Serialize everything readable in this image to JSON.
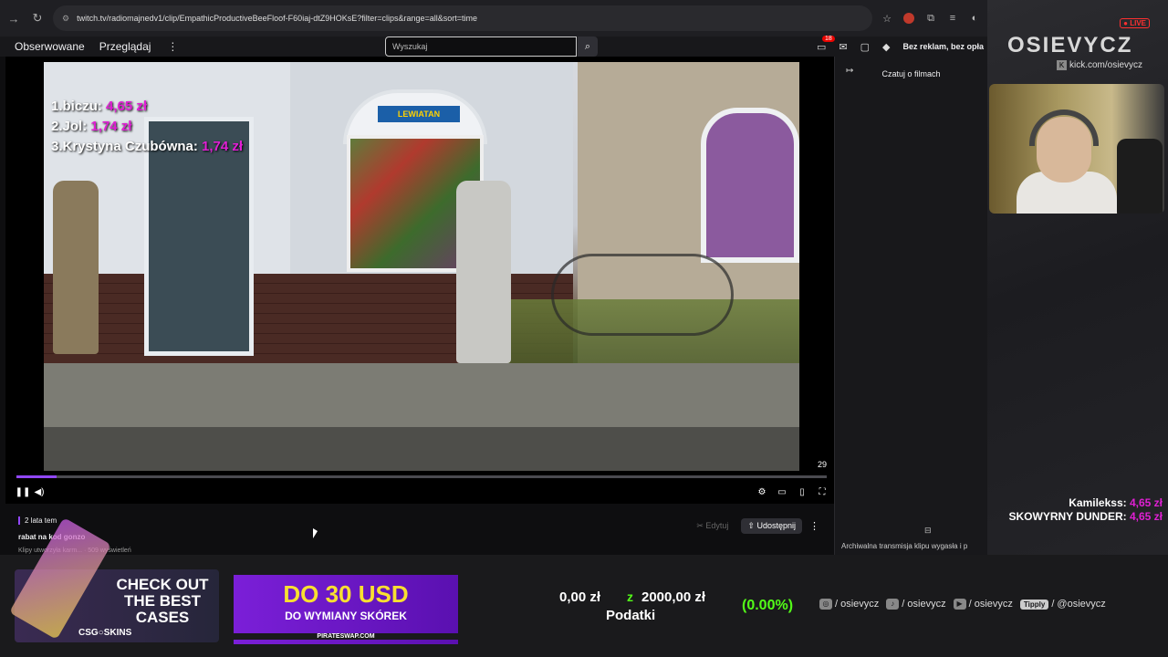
{
  "browser": {
    "url": "twitch.tv/radiomajnedv1/clip/EmpathicProductiveBeeFloof-F60iaj-dtZ9HOKsE?filter=clips&range=all&sort=time",
    "back_icon": "arrow-left-icon",
    "reload_icon": "reload-icon"
  },
  "nav": {
    "followed": "Obserwowane",
    "browse": "Przeglądaj",
    "more": "⋮",
    "search_placeholder": "Wyszukaj",
    "notifications_count": "18",
    "promo": "Bez reklam, bez opła"
  },
  "video": {
    "shop_sign": "LEWIATAN",
    "ranking": [
      {
        "rank": "1.",
        "name": "biczu:",
        "amount": "4,65 zł"
      },
      {
        "rank": "2.",
        "name": "Jol:",
        "amount": "1,74 zł"
      },
      {
        "rank": "3.",
        "name": "Krystyna Czubówna:",
        "amount": "1,74 zł"
      }
    ],
    "clip_counter": "29",
    "progress": 0.05
  },
  "clip": {
    "age": "2 lata tem",
    "title": "rabat na kod gonzo",
    "meta": "Klipy utworzyła karm... · 509 wyświetleń",
    "edit_label": "Edytuj",
    "share_label": "Udostępnij"
  },
  "chat": {
    "title": "Czatuj o filmach",
    "archived": "Archiwalna transmisja klipu wygasła i p"
  },
  "overlay": {
    "live": "● LIVE",
    "brand": "OSIEVYCZ",
    "kick": "kick.com/osievycz",
    "donors": [
      {
        "name": "Kamilekss:",
        "amount": "4,65 zł"
      },
      {
        "name": "SKOWYRNY DUNDER:",
        "amount": "4,65 zł"
      }
    ]
  },
  "bottom": {
    "ad1_text": "CHECK OUT THE BEST CASES",
    "ad1_brand": "CSG○SKINS",
    "ad2_main": "DO 30 USD",
    "ad2_sub": "DO WYMIANY SKÓREK",
    "ad2_url": "PIRATESWAP.COM",
    "goal_current": "0,00 zł",
    "goal_separator": "z",
    "goal_target": "2000,00 zł",
    "goal_label": "Podatki",
    "goal_percent": "(0.00%)",
    "socials": [
      {
        "icon": "instagram-icon",
        "label": "/ osievycz"
      },
      {
        "icon": "tiktok-icon",
        "label": "/ osievycz"
      },
      {
        "icon": "youtube-icon",
        "label": "/ osievycz"
      }
    ],
    "tipply_badge": "Tipply",
    "tipply_label": "/ @osievycz"
  }
}
